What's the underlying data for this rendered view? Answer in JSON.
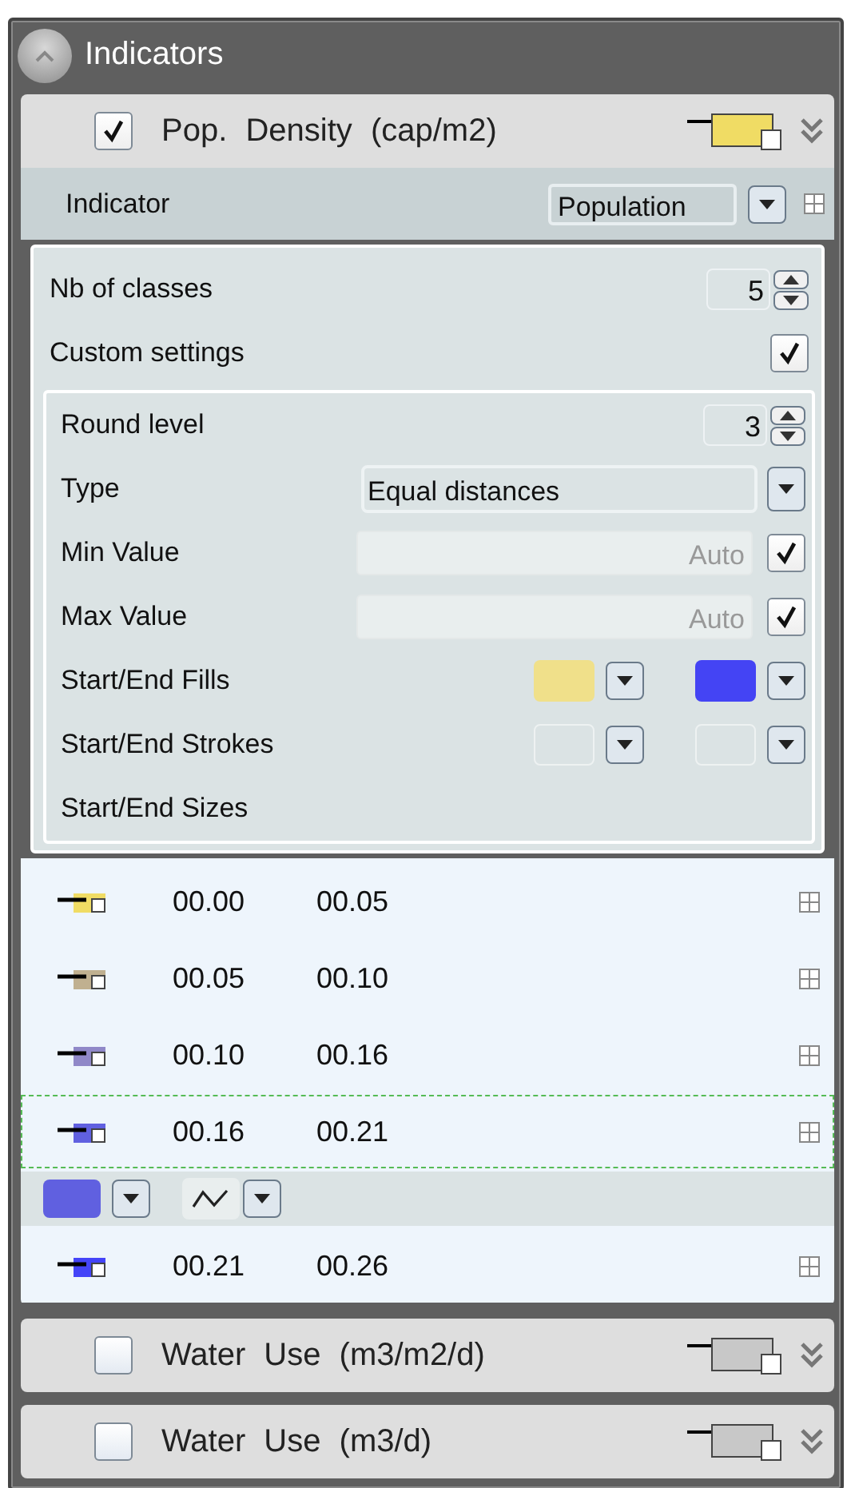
{
  "panel": {
    "title": "Indicators"
  },
  "indicators": [
    {
      "label": "Pop. Density (cap/m2)",
      "checked": true,
      "color": "#f0dc64",
      "indicator": {
        "label": "Indicator",
        "value": "Population"
      },
      "settings": [
        {
          "kind": "spinner",
          "label": "Nb of classes",
          "value": "5"
        },
        {
          "kind": "checkbox",
          "label": "Custom settings",
          "checked": true
        }
      ],
      "custom": [
        {
          "kind": "spinner",
          "label": "Round level",
          "value": "3"
        },
        {
          "kind": "select",
          "label": "Type",
          "value": "Equal distances"
        },
        {
          "kind": "auto",
          "label": "Min Value",
          "placeholder": "Auto",
          "checked": true
        },
        {
          "kind": "auto",
          "label": "Max Value",
          "placeholder": "Auto",
          "checked": true
        },
        {
          "kind": "colors",
          "label": "Start/End Fills",
          "swatches": [
            {
              "color": "#f0e08a"
            },
            {
              "color": "#4444f4"
            }
          ]
        },
        {
          "kind": "colors",
          "label": "Start/End Strokes"
        },
        {
          "kind": "plain",
          "label": "Start/End Sizes"
        }
      ],
      "classes": [
        {
          "from": "00.00",
          "to": "00.05",
          "color": "#f0dc64",
          "selected": false
        },
        {
          "from": "00.05",
          "to": "00.10",
          "color": "#c0b090",
          "selected": false
        },
        {
          "from": "00.10",
          "to": "00.16",
          "color": "#9088c8",
          "selected": false
        },
        {
          "from": "00.16",
          "to": "00.21",
          "color": "#6060e0",
          "selected": true
        },
        {
          "from": "00.21",
          "to": "00.26",
          "color": "#4444f8",
          "selected": false
        }
      ]
    },
    {
      "label": "Water Use (m3/m2/d)",
      "checked": false,
      "color": "#c8c8c8"
    },
    {
      "label": "Water Use (m3/d)",
      "checked": false,
      "color": "#c8c8c8"
    }
  ]
}
